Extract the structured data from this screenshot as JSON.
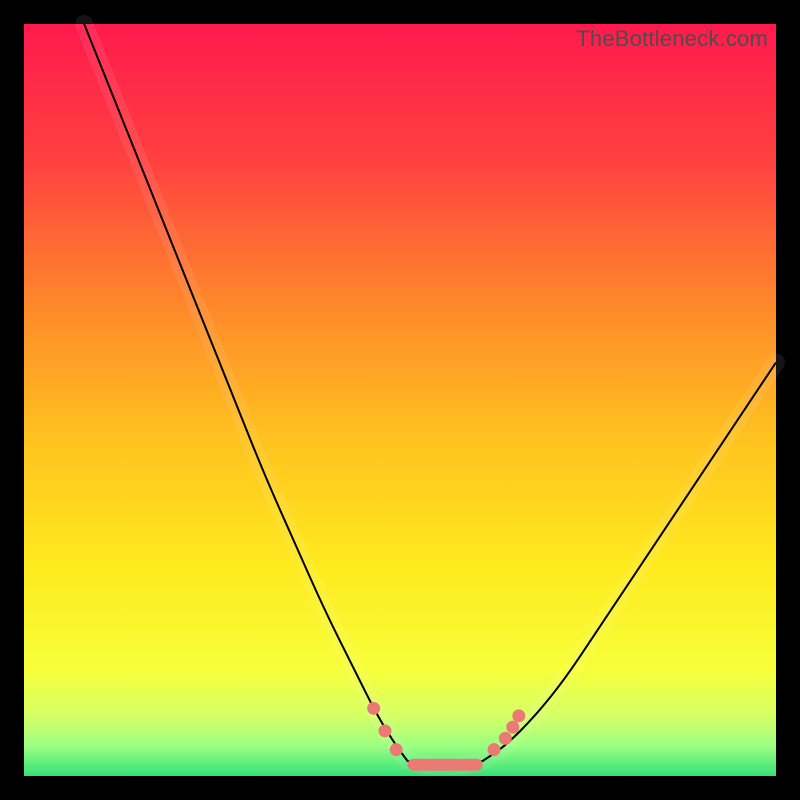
{
  "watermark": "TheBottleneck.com",
  "colors": {
    "frame": "#000000",
    "curve": "#000000",
    "marker": "#ea7a73",
    "gradient_stops": [
      {
        "pct": 0,
        "color": "#ff1a4d"
      },
      {
        "pct": 18,
        "color": "#ff4040"
      },
      {
        "pct": 38,
        "color": "#ff8a2a"
      },
      {
        "pct": 55,
        "color": "#ffc21f"
      },
      {
        "pct": 72,
        "color": "#ffea1f"
      },
      {
        "pct": 86,
        "color": "#f6ff3a"
      },
      {
        "pct": 92,
        "color": "#d6ff66"
      },
      {
        "pct": 96,
        "color": "#9cff80"
      },
      {
        "pct": 100,
        "color": "#35e07a"
      }
    ]
  },
  "chart_data": {
    "type": "line",
    "title": "",
    "xlabel": "",
    "ylabel": "",
    "x_range": [
      0,
      100
    ],
    "y_range": [
      0,
      100
    ],
    "note": "Axes are unlabeled in the source image; values below are normalized 0-100 estimates read from pixel positions (y = bottleneck %, lower is better).",
    "series": [
      {
        "name": "left-branch",
        "x": [
          8,
          12,
          16,
          20,
          24,
          28,
          32,
          36,
          40,
          44,
          47,
          49.5,
          51
        ],
        "y": [
          100,
          90,
          80,
          70,
          60,
          50,
          40,
          31,
          22,
          14,
          8,
          4,
          2
        ]
      },
      {
        "name": "valley-floor",
        "x": [
          51,
          53,
          55,
          57,
          59,
          61
        ],
        "y": [
          2,
          1.5,
          1.3,
          1.3,
          1.5,
          2
        ]
      },
      {
        "name": "right-branch",
        "x": [
          61,
          64,
          68,
          72,
          76,
          80,
          84,
          88,
          92,
          96,
          100
        ],
        "y": [
          2,
          4,
          8,
          13,
          19,
          25,
          31,
          37,
          43,
          49,
          55
        ]
      }
    ],
    "markers": {
      "name": "highlighted-points",
      "color": "#ea7a73",
      "points": [
        {
          "x": 46.5,
          "y": 9
        },
        {
          "x": 48.0,
          "y": 6
        },
        {
          "x": 49.5,
          "y": 3.5
        },
        {
          "x": 62.5,
          "y": 3.5
        },
        {
          "x": 64.0,
          "y": 5
        },
        {
          "x": 65.0,
          "y": 6.5
        },
        {
          "x": 65.8,
          "y": 8
        }
      ],
      "floor_segment": {
        "x_start": 51,
        "x_end": 61,
        "y": 1.5
      }
    }
  }
}
